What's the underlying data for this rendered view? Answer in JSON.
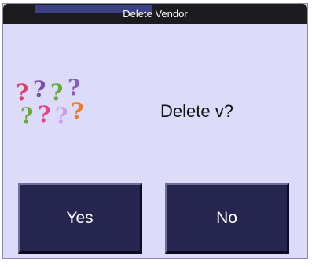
{
  "dialog": {
    "title": "Delete Vendor",
    "message": "Delete v?",
    "icon": "question-marks-icon",
    "buttons": {
      "yes_label": "Yes",
      "no_label": "No"
    }
  },
  "colors": {
    "dialog_background": "#dcdcfa",
    "titlebar": "#1c1c1e",
    "button_background": "#25254f",
    "button_text": "#ffffff"
  }
}
